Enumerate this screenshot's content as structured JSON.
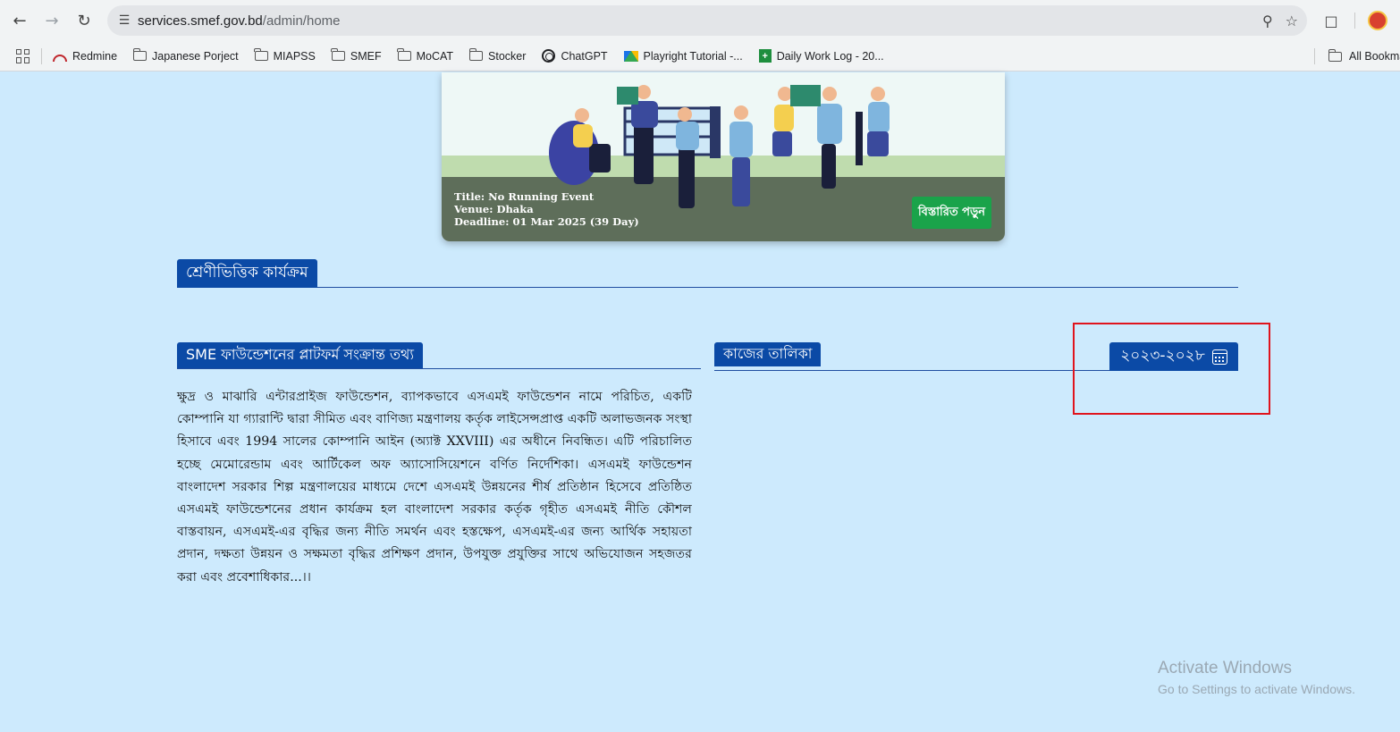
{
  "browser": {
    "url_host": "services.smef.gov.bd",
    "url_path": "/admin/home",
    "bookmarks": [
      "Redmine",
      "Japanese Porject",
      "MIAPSS",
      "SMEF",
      "MoCAT",
      "Stocker",
      "ChatGPT",
      "Playright Tutorial -...",
      "Daily Work Log - 20..."
    ],
    "all_bookmarks": "All Bookmarks"
  },
  "event": {
    "title": "Title: No Running Event",
    "venue": "Venue: Dhaka",
    "deadline": "Deadline: 01 Mar 2025 (39 Day)",
    "details_button": "বিস্তারিত পড়ুন"
  },
  "categories": {
    "heading": "শ্রেণীভিত্তিক কার্যক্রম"
  },
  "about": {
    "heading": "SME ফাউন্ডেশনের প্লাটফর্ম সংক্রান্ত তথ্য",
    "text": "ক্ষুদ্র ও মাঝারি এন্টারপ্রাইজ ফাউন্ডেশন, ব্যাপকভাবে এসএমই ফাউন্ডেশন নামে পরিচিত, একটি কোম্পানি যা গ্যারান্টি দ্বারা সীমিত এবং বাণিজ্য মন্ত্রণালয় কর্তৃক লাইসেন্সপ্রাপ্ত একটি অলাভজনক সংস্থা হিসাবে এবং 1994 সালের কোম্পানি আইন (অ্যাক্ট XXVIII) এর অধীনে নিবন্ধিত। এটি পরিচালিত হচ্ছে মেমোরেন্ডাম এবং আর্টিকেল অফ অ্যাসোসিয়েশনে বর্ণিত নির্দেশিকা। এসএমই ফাউন্ডেশন বাংলাদেশ সরকার শিল্প মন্ত্রণালয়ের মাধ্যমে দেশে এসএমই উন্নয়নের শীর্ষ প্রতিষ্ঠান হিসেবে প্রতিষ্ঠিত এসএমই ফাউন্ডেশনের প্রধান কার্যক্রম হল বাংলাদেশ সরকার কর্তৃক গৃহীত এসএমই নীতি কৌশল বাস্তবায়ন, এসএমই-এর বৃদ্ধির জন্য নীতি সমর্থন এবং হস্তক্ষেপ, এসএমই-এর জন্য আর্থিক সহায়তা প্রদান, দক্ষতা উন্নয়ন ও সক্ষমতা বৃদ্ধির প্রশিক্ষণ প্রদান, উপযুক্ত প্রযুক্তির সাথে অভিযোজন সহজতর করা এবং প্রবেশাধিকার...।।"
  },
  "tasks": {
    "heading": "কাজের তালিকা",
    "year_button": "২০২৩-২০২৮"
  },
  "watermark": {
    "title": "Activate Windows",
    "subtitle": "Go to Settings to activate Windows."
  },
  "icons": [
    "back-icon",
    "forward-icon",
    "reload-icon",
    "site-info-icon",
    "zoom-icon",
    "star-icon",
    "extensions-icon",
    "apps-icon",
    "folder-icon",
    "calendar-icon"
  ]
}
